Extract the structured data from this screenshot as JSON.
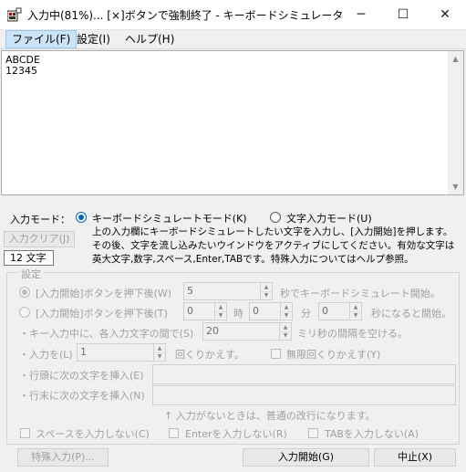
{
  "window": {
    "title": "入力中(81%)... [×]ボタンで強制終了 - キーボードシミュレータ",
    "minimize_glyph": "─",
    "maximize_glyph": "☐",
    "close_glyph": "✕"
  },
  "menu": {
    "file": "ファイル(F)",
    "settings": "設定(I)",
    "help": "ヘルプ(H)"
  },
  "input_text": "ABCDE\n12345",
  "input_mode": {
    "label": "入力モード：",
    "keyboard_mode": "キーボードシミュレートモード(K)",
    "char_mode": "文字入力モード(U)",
    "selected": "keyboard"
  },
  "clear_button": "入力クリア(J)",
  "char_count": "12 文字",
  "description": "上の入力欄にキーボードシミュレートしたい文字を入力し、[入力開始]を押します。その後、文字を流し込みたいウインドウをアクティブにしてください。有効な文字は英大文字,数字,スペース,Enter,TABです。特殊入力についてはヘルプ参照。",
  "settings": {
    "group_label": "設定",
    "option1_label": "[入力開始]ボタンを押下後(W)",
    "option1_value": "5",
    "option1_suffix": "秒でキーボードシミュレート開始。",
    "option2_label": "[入力開始]ボタンを押下後(T)",
    "option2_hours": "0",
    "option2_hours_unit": "時",
    "option2_minutes": "0",
    "option2_minutes_unit": "分",
    "option2_seconds": "0",
    "option2_suffix": "秒になると開始。",
    "interval_label": "・キー入力中に、各入力文字の間で(S)",
    "interval_value": "20",
    "interval_suffix": "ミリ秒の間隔を空ける。",
    "repeat_label": "・入力を(L)",
    "repeat_value": "1",
    "repeat_suffix": "回くりかえす。",
    "infinite_repeat": "無限回くりかえす(Y)",
    "line_head_label": "・行頭に次の文字を挿入(E)",
    "line_head_value": "",
    "line_end_label": "・行末に次の文字を挿入(N)",
    "line_end_value": "",
    "note": "↑ 入力がないときは、普通の改行になります。",
    "no_space": "スペースを入力しない(C)",
    "no_enter": "Enterを入力しない(R)",
    "no_tab": "TABを入力しない(A)"
  },
  "buttons": {
    "special": "特殊入力(P)...",
    "start": "入力開始(G)",
    "stop": "中止(X)"
  }
}
